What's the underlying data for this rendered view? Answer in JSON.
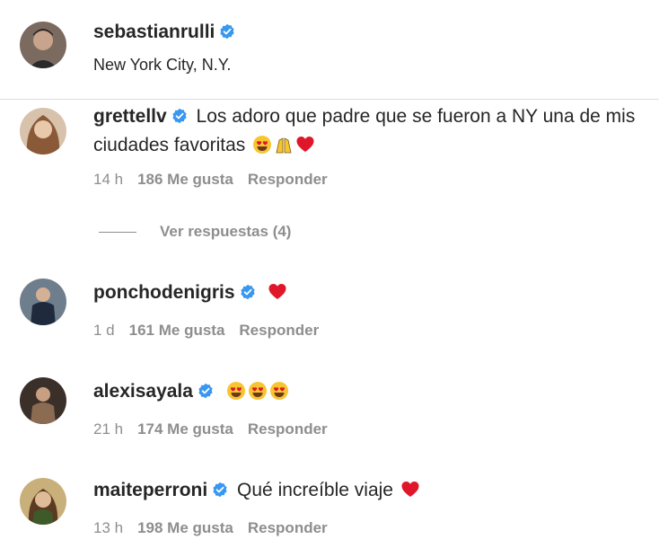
{
  "post": {
    "username": "sebastianrulli",
    "location": "New York City, N.Y."
  },
  "comments": [
    {
      "username": "grettellv",
      "text": "Los adoro que padre que se fueron a NY una de mis ciudades favoritas",
      "emojis": [
        "heart-eyes-emoji",
        "praying-hands-emoji",
        "red-heart-emoji"
      ],
      "time": "14 h",
      "likes": "186 Me gusta",
      "reply": "Responder",
      "view_replies": "Ver respuestas (4)"
    },
    {
      "username": "ponchodenigris",
      "text": "",
      "emojis": [
        "red-heart-emoji"
      ],
      "time": "1 d",
      "likes": "161 Me gusta",
      "reply": "Responder"
    },
    {
      "username": "alexisayala",
      "text": "",
      "emojis": [
        "heart-eyes-emoji",
        "heart-eyes-emoji",
        "heart-eyes-emoji"
      ],
      "time": "21 h",
      "likes": "174 Me gusta",
      "reply": "Responder"
    },
    {
      "username": "maiteperroni",
      "text": "Qué increíble viaje",
      "emojis": [
        "red-heart-emoji"
      ],
      "time": "13 h",
      "likes": "198 Me gusta",
      "reply": "Responder"
    }
  ],
  "colors": {
    "verified": "#3897f0",
    "secondary_text": "#8e8e8e",
    "heart": "#e0162b"
  }
}
